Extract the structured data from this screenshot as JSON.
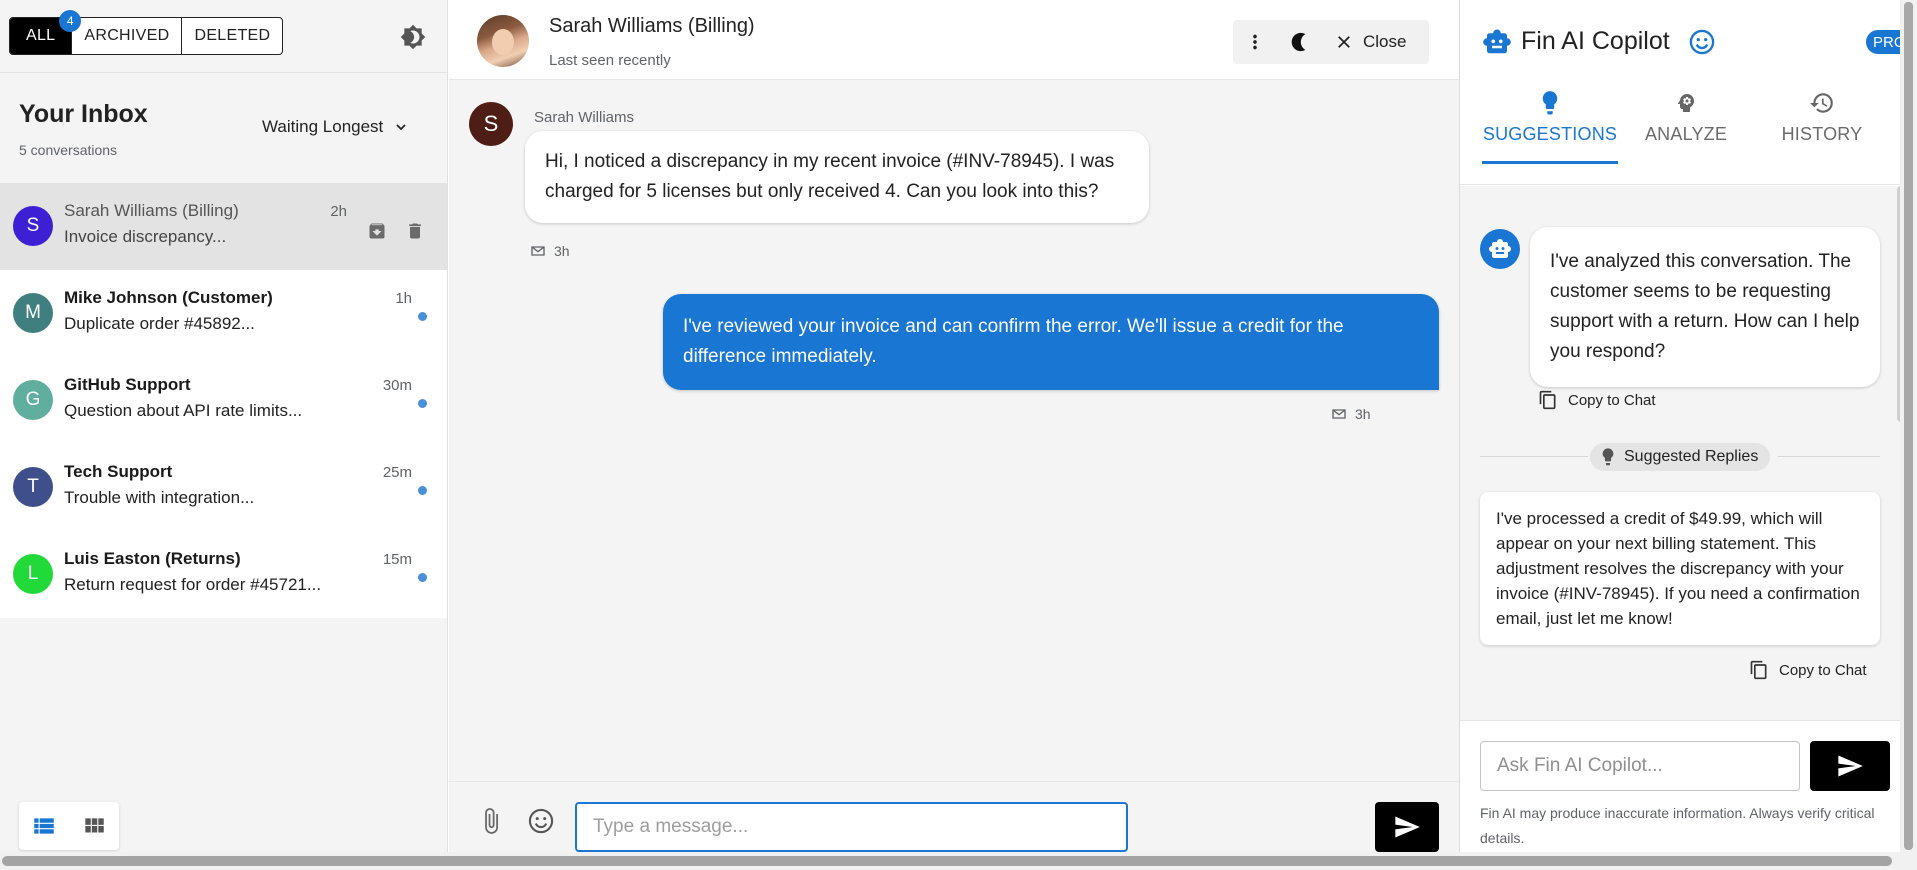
{
  "inbox": {
    "filters": [
      {
        "label": "ALL",
        "badge": "4",
        "active": true
      },
      {
        "label": "ARCHIVED"
      },
      {
        "label": "DELETED"
      }
    ],
    "title": "Your Inbox",
    "count_text": "5 conversations",
    "sort_label": "Waiting Longest",
    "conversations": [
      {
        "initial": "S",
        "name": "Sarah Williams (Billing)",
        "preview": "Invoice discrepancy...",
        "time": "2h",
        "color": "#3d1fd4",
        "selected": true
      },
      {
        "initial": "M",
        "name": "Mike Johnson (Customer)",
        "preview": "Duplicate order #45892...",
        "time": "1h",
        "color": "#3f7f7f",
        "unread": true
      },
      {
        "initial": "G",
        "name": "GitHub Support",
        "preview": "Question about API rate limits...",
        "time": "30m",
        "color": "#5fae9e",
        "unread": true
      },
      {
        "initial": "T",
        "name": "Tech Support",
        "preview": "Trouble with integration...",
        "time": "25m",
        "color": "#3f4f8c",
        "unread": true
      },
      {
        "initial": "L",
        "name": "Luis Easton (Returns)",
        "preview": "Return request for order #45721...",
        "time": "15m",
        "color": "#22d93a",
        "unread": true
      }
    ]
  },
  "chat": {
    "contact_name": "Sarah Williams (Billing)",
    "status": "Last seen recently",
    "close_label": "Close",
    "messages": [
      {
        "direction": "in",
        "sender": "Sarah Williams",
        "initial": "S",
        "text": "Hi, I noticed a discrepancy in my recent invoice (#INV-78945). I was charged for 5 licenses but only received 4. Can you look into this?",
        "time": "3h"
      },
      {
        "direction": "out",
        "text": "I've reviewed your invoice and can confirm the error. We'll issue a credit for the difference immediately.",
        "time": "3h"
      }
    ],
    "composer_placeholder": "Type a message..."
  },
  "copilot": {
    "title": "Fin AI Copilot",
    "plan_badge": "PRO",
    "tabs": [
      {
        "label": "SUGGESTIONS",
        "icon": "lightbulb-icon",
        "active": true
      },
      {
        "label": "ANALYZE",
        "icon": "head-gear-icon"
      },
      {
        "label": "HISTORY",
        "icon": "history-icon"
      }
    ],
    "bot_message": "I've analyzed this conversation. The customer seems to be requesting support with a return. How can I help you respond?",
    "copy_label": "Copy to Chat",
    "suggested_label": "Suggested Replies",
    "suggested_reply": "I've processed a credit of $49.99, which will appear on your next billing statement. This adjustment resolves the discrepancy with your invoice (#INV-78945). If you need a confirmation email, just let me know!",
    "ask_placeholder": "Ask Fin AI Copilot...",
    "disclaimer": "Fin AI may produce inaccurate information. Always verify critical details."
  },
  "colors": {
    "accent": "#1976d2",
    "selected_row": "#e3e3e3",
    "unread_dot": "#4a90d9"
  }
}
